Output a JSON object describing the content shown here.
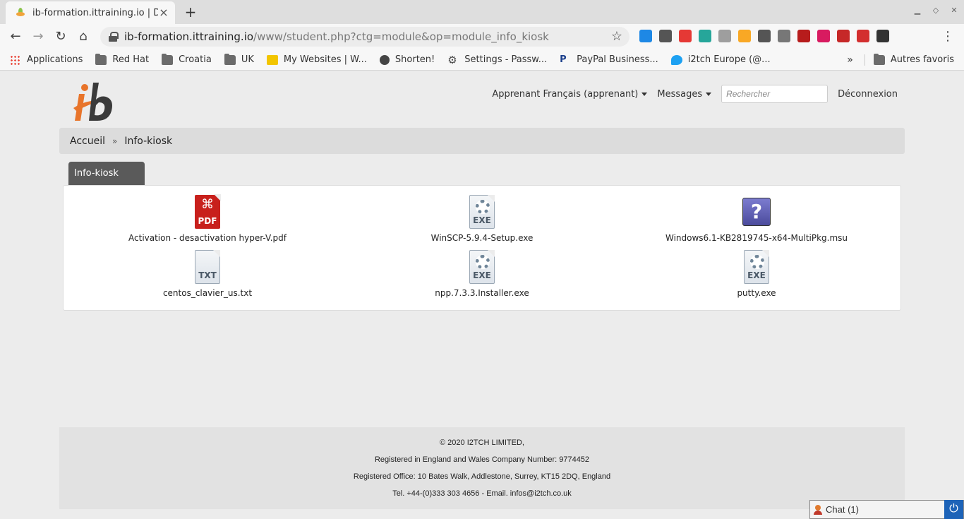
{
  "browser": {
    "tab_title": "ib-formation.ittraining.io | DO",
    "new_tab": "+",
    "url_host": "ib-formation.ittraining.io",
    "url_path": "/www/student.php?ctg=module&op=module_info_kiosk",
    "bookmarks": [
      {
        "label": "Applications",
        "icon": "apps-grid-icon"
      },
      {
        "label": "Red Hat",
        "icon": "folder-icon"
      },
      {
        "label": "Croatia",
        "icon": "folder-icon"
      },
      {
        "label": "UK",
        "icon": "folder-icon"
      },
      {
        "label": "My Websites | W...",
        "icon": "site-icon"
      },
      {
        "label": "Shorten!",
        "icon": "globe-icon"
      },
      {
        "label": "Settings - Passw...",
        "icon": "gear-icon"
      },
      {
        "label": "PayPal Business...",
        "icon": "paypal-icon"
      },
      {
        "label": "i2tch Europe (@...",
        "icon": "twitter-icon"
      }
    ],
    "bookmarks_more": "»",
    "other_bookmarks": "Autres favoris",
    "extension_colors": [
      "#1e88e5",
      "#555555",
      "#e53935",
      "#26a69a",
      "#9e9e9e",
      "#f9a825",
      "#555555",
      "#777777",
      "#b71c1c",
      "#d81b60",
      "#c62828",
      "#d32f2f",
      "#333333"
    ]
  },
  "header": {
    "user_menu": "Apprenant Français (apprenant)",
    "messages_menu": "Messages",
    "search_placeholder": "Rechercher",
    "logout": "Déconnexion"
  },
  "breadcrumb": {
    "home": "Accueil",
    "separator": "»",
    "current": "Info-kiosk"
  },
  "panel": {
    "tab_label": "Info-kiosk",
    "files": [
      {
        "name": "Activation - desactivation hyper-V.pdf",
        "type": "PDF",
        "icon": "pdf-file-icon"
      },
      {
        "name": "WinSCP-5.9.4-Setup.exe",
        "type": "EXE",
        "icon": "exe-file-icon"
      },
      {
        "name": "Windows6.1-KB2819745-x64-MultiPkg.msu",
        "type": "?",
        "icon": "unknown-file-icon"
      },
      {
        "name": "centos_clavier_us.txt",
        "type": "TXT",
        "icon": "txt-file-icon"
      },
      {
        "name": "npp.7.3.3.Installer.exe",
        "type": "EXE",
        "icon": "exe-file-icon"
      },
      {
        "name": "putty.exe",
        "type": "EXE",
        "icon": "exe-file-icon"
      }
    ]
  },
  "footer": {
    "line1": "© 2020 I2TCH LIMITED,",
    "line2": "Registered in England and Wales Company Number: 9774452",
    "line3": "Registered Office: 10 Bates Walk, Addlestone, Surrey, KT15 2DQ, England",
    "line4": "Tel. +44-(0)333 303 4656 - Email. infos@i2tch.co.uk"
  },
  "chat": {
    "label": "Chat (1)"
  }
}
